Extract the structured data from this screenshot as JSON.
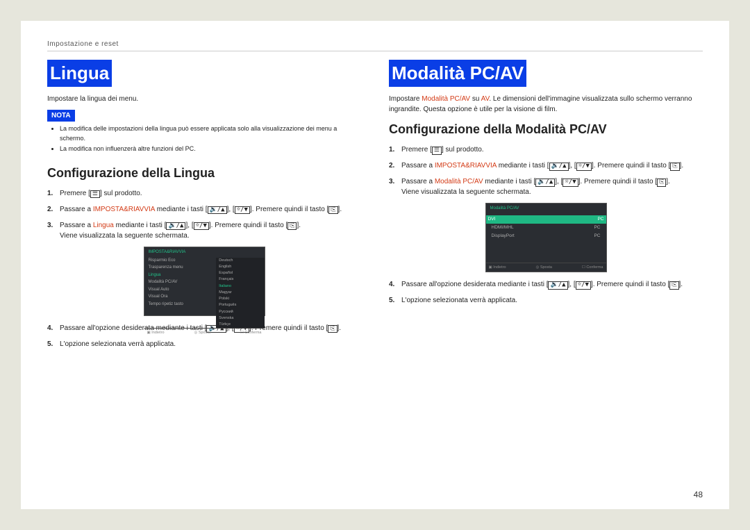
{
  "header": "Impostazione e reset",
  "pageNumber": "48",
  "left": {
    "h1": "Lingua",
    "intro": "Impostare la lingua dei menu.",
    "notaLabel": "NOTA",
    "notes": [
      "La modifica delle impostazioni della lingua può essere applicata solo alla visualizzazione dei menu a schermo.",
      "La modifica non influenzerà altre funzioni del PC."
    ],
    "h2": "Configurazione della Lingua",
    "steps": {
      "s1a": "Premere [",
      "s1b": "] sul prodotto.",
      "s2a": "Passare a ",
      "s2kw": "IMPOSTA&RIAVVIA",
      "s2b": " mediante i tasti [",
      "s2c": "], [",
      "s2d": "]. Premere quindi il tasto [",
      "s2e": "].",
      "s3a": "Passare a ",
      "s3kw": "Lingua",
      "s3b": " mediante i tasti [",
      "s3c": "], [",
      "s3d": "]. Premere quindi il tasto [",
      "s3e": "].",
      "s3f": "Viene visualizzata la seguente schermata.",
      "s4a": "Passare all'opzione desiderata mediante i tasti [",
      "s4b": "], [",
      "s4c": "]. Premere quindi il tasto [",
      "s4d": "].",
      "s5": "L'opzione selezionata verrà applicata."
    },
    "osd": {
      "title": "IMPOSTA&RIAVVIA",
      "leftItems": [
        "Risparmio Eco",
        "Trasparenza menu",
        "Lingua",
        "Modalità PC/AV",
        "Visual Auto",
        "Visual Ora",
        "Tempo ripetiz tasto"
      ],
      "selectedIndex": 2,
      "rightItems": [
        "Deutsch",
        "English",
        "Español",
        "Français",
        "Italiano",
        "Magyar",
        "Polski",
        "Português",
        "Русский",
        "Svenska",
        "Türkçe"
      ],
      "rightSelected": 4,
      "foot": [
        "▣ Indietro",
        "◎ Sposta",
        "☐ Conferma"
      ]
    }
  },
  "right": {
    "h1": "Modalità PC/AV",
    "introA": "Impostare ",
    "introKw1": "Modalità PC/AV",
    "introB": " su ",
    "introKw2": "AV",
    "introC": ". Le dimensioni dell'immagine visualizzata sullo schermo verranno ingrandite. Questa opzione è utile per la visione di film.",
    "h2": "Configurazione della Modalità PC/AV",
    "steps": {
      "s1a": "Premere [",
      "s1b": "] sul prodotto.",
      "s2a": "Passare a ",
      "s2kw": "IMPOSTA&RIAVVIA",
      "s2b": " mediante i tasti [",
      "s2c": "], [",
      "s2d": "]. Premere quindi il tasto [",
      "s2e": "].",
      "s3a": "Passare a ",
      "s3kw": "Modalità PC/AV",
      "s3b": " mediante i tasti [",
      "s3c": "], [",
      "s3d": "]. Premere quindi il tasto [",
      "s3e": "].",
      "s3f": "Viene visualizzata la seguente schermata.",
      "s4a": "Passare all'opzione desiderata mediante i tasti [",
      "s4b": "], [",
      "s4c": "]. Premere quindi il tasto [",
      "s4d": "].",
      "s5": "L'opzione selezionata verrà applicata."
    },
    "osd": {
      "title": "Modalità PC/AV",
      "rows": [
        {
          "label": "DVI",
          "value": "PC",
          "hl": true
        },
        {
          "label": "HDMI/MHL",
          "value": "PC",
          "hl": false
        },
        {
          "label": "DisplayPort",
          "value": "PC",
          "hl": false
        }
      ],
      "foot": [
        "▣ Indietro",
        "◎ Sposta",
        "☐ Conferma"
      ]
    }
  },
  "icons": {
    "menu": "☰",
    "volUp": "🔉/▲",
    "brightUp": "☼/▼",
    "enter": "⎘"
  }
}
